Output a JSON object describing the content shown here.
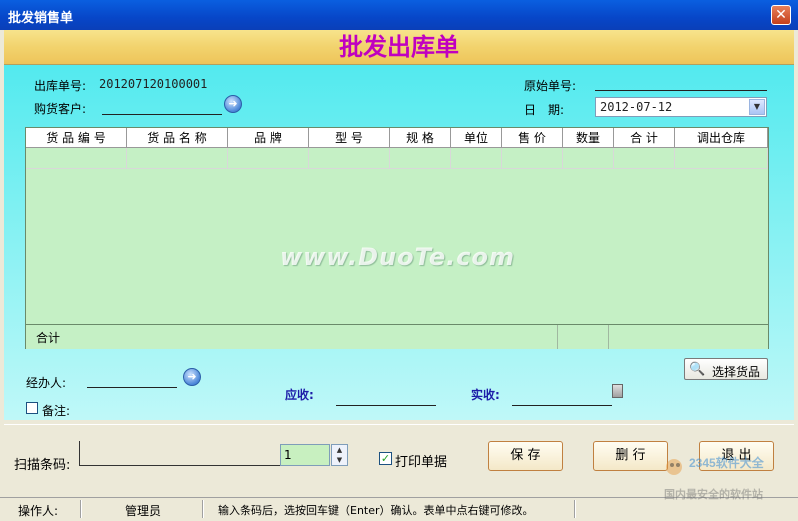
{
  "window": {
    "title": "批发销售单",
    "close_glyph": "✕"
  },
  "header": {
    "title": "批发出库单"
  },
  "form": {
    "out_no_label": "出库单号:",
    "out_no_value": "201207120100001",
    "customer_label": "购货客户:",
    "customer_value": "",
    "orig_no_label": "原始单号:",
    "orig_no_value": "",
    "date_label": "日　期:",
    "date_value": "2012-07-12"
  },
  "grid": {
    "columns": [
      "货 品 编 号",
      "货 品 名 称",
      "品 牌",
      "型 号",
      "规 格",
      "单位",
      "售 价",
      "数量",
      "合 计",
      "调出仓库"
    ],
    "footer_label": "合计"
  },
  "watermark": "www.DuoTe.com",
  "bottom": {
    "handler_label": "经办人:",
    "remark_label": "备注:",
    "receivable_label": "应收:",
    "received_label": "实收:",
    "select_goods_label": "选择货品"
  },
  "actions": {
    "scan_label": "扫描条码:",
    "qty_value": "1",
    "print_label": "打印单据",
    "print_checked": "✓",
    "save_label": "保 存",
    "delete_label": "删 行",
    "exit_label": "退 出"
  },
  "status": {
    "operator_label": "操作人:",
    "operator_value": "管理员",
    "hint": "输入条码后，选按回车键（Enter）确认。表单中点右键可修改。"
  },
  "brand": {
    "text": "2345软件大全",
    "slogan": "国内最安全的软件站"
  },
  "icons": {
    "go": "arrow-right-icon",
    "search": "magnifier-icon",
    "calc": "calculator-icon",
    "dropdown": "chevron-down-icon"
  },
  "colors": {
    "header_title": "#c000c0",
    "grid_bg": "#c5f0c5",
    "panel": "#48e8ee",
    "label_blue": "#1d1da8"
  }
}
